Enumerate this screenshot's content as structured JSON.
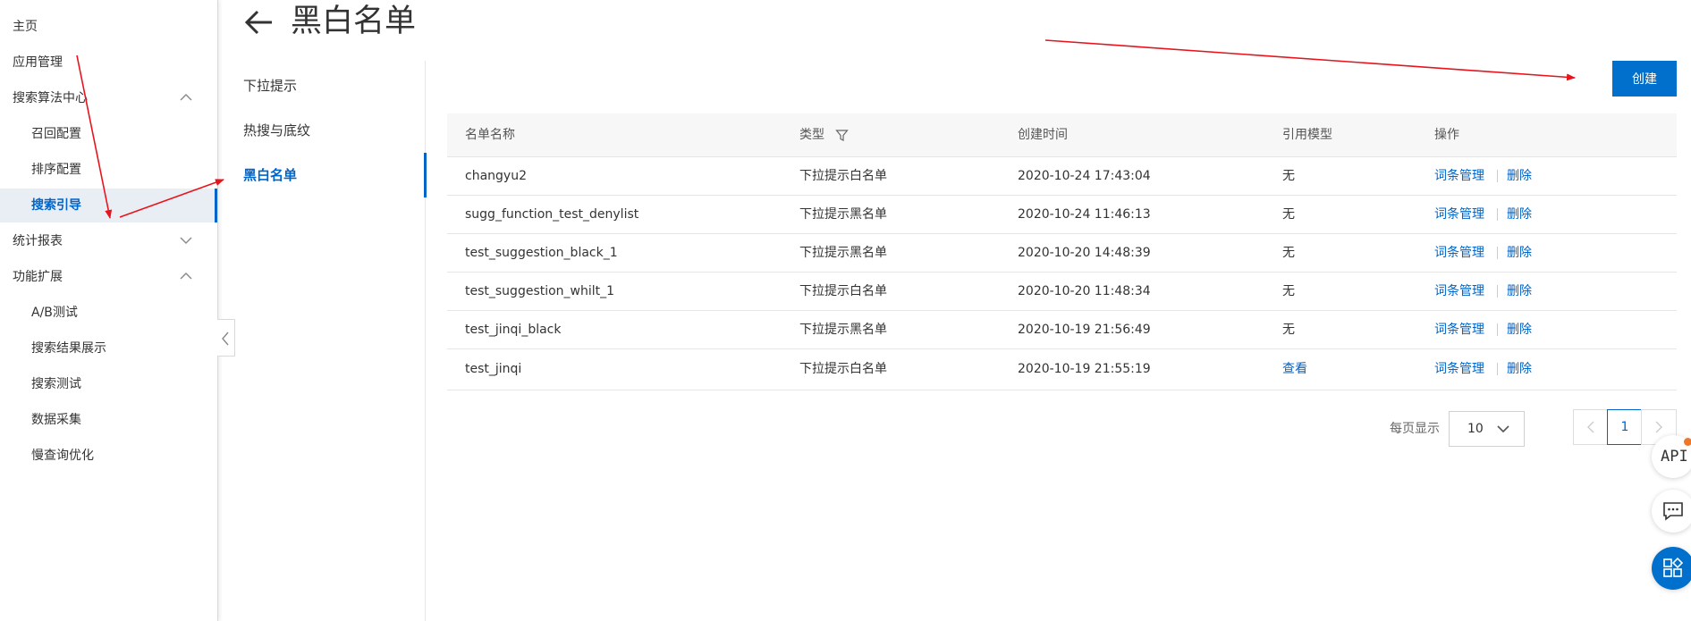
{
  "sidebar": {
    "items": [
      {
        "label": "主页"
      },
      {
        "label": "应用管理"
      },
      {
        "label": "搜索算法中心"
      },
      {
        "label": "召回配置"
      },
      {
        "label": "排序配置"
      },
      {
        "label": "搜索引导"
      },
      {
        "label": "统计报表"
      },
      {
        "label": "功能扩展"
      },
      {
        "label": "A/B测试"
      },
      {
        "label": "搜索结果展示"
      },
      {
        "label": "搜索测试"
      },
      {
        "label": "数据采集"
      },
      {
        "label": "慢查询优化"
      }
    ],
    "active": "搜索引导"
  },
  "header": {
    "title": "黑白名单"
  },
  "subnav": {
    "items": [
      {
        "label": "下拉提示"
      },
      {
        "label": "热搜与底纹"
      },
      {
        "label": "黑白名单"
      }
    ],
    "active": "黑白名单"
  },
  "toolbar": {
    "create_label": "创建"
  },
  "table": {
    "columns": [
      "名单名称",
      "类型",
      "创建时间",
      "引用模型",
      "操作"
    ],
    "rows": [
      {
        "name": "changyu2",
        "type": "下拉提示白名单",
        "created": "2020-10-24 17:43:04",
        "model": "无",
        "action_manage": "词条管理",
        "action_delete": "删除"
      },
      {
        "name": "sugg_function_test_denylist",
        "type": "下拉提示黑名单",
        "created": "2020-10-24 11:46:13",
        "model": "无",
        "action_manage": "词条管理",
        "action_delete": "删除"
      },
      {
        "name": "test_suggestion_black_1",
        "type": "下拉提示黑名单",
        "created": "2020-10-20 14:48:39",
        "model": "无",
        "action_manage": "词条管理",
        "action_delete": "删除"
      },
      {
        "name": "test_suggestion_whilt_1",
        "type": "下拉提示白名单",
        "created": "2020-10-20 11:48:34",
        "model": "无",
        "action_manage": "词条管理",
        "action_delete": "删除"
      },
      {
        "name": "test_jinqi_black",
        "type": "下拉提示黑名单",
        "created": "2020-10-19 21:56:49",
        "model": "无",
        "action_manage": "词条管理",
        "action_delete": "删除"
      },
      {
        "name": "test_jinqi",
        "type": "下拉提示白名单",
        "created": "2020-10-19 21:55:19",
        "model": "查看",
        "action_manage": "词条管理",
        "action_delete": "删除"
      }
    ]
  },
  "pagination": {
    "page_size_label": "每页显示",
    "page_size": "10",
    "current_page": "1"
  },
  "floating": {
    "api_label": "API"
  },
  "colors": {
    "accent": "#0064c8",
    "button": "#0070cc",
    "annotation": "#e8141c",
    "notification_dot": "#f0772a"
  },
  "icons": [
    "back-arrow-icon",
    "chevron-up-icon",
    "chevron-down-icon",
    "filter-icon",
    "chevron-left-icon",
    "chevron-right-icon",
    "chat-icon",
    "apps-icon"
  ]
}
